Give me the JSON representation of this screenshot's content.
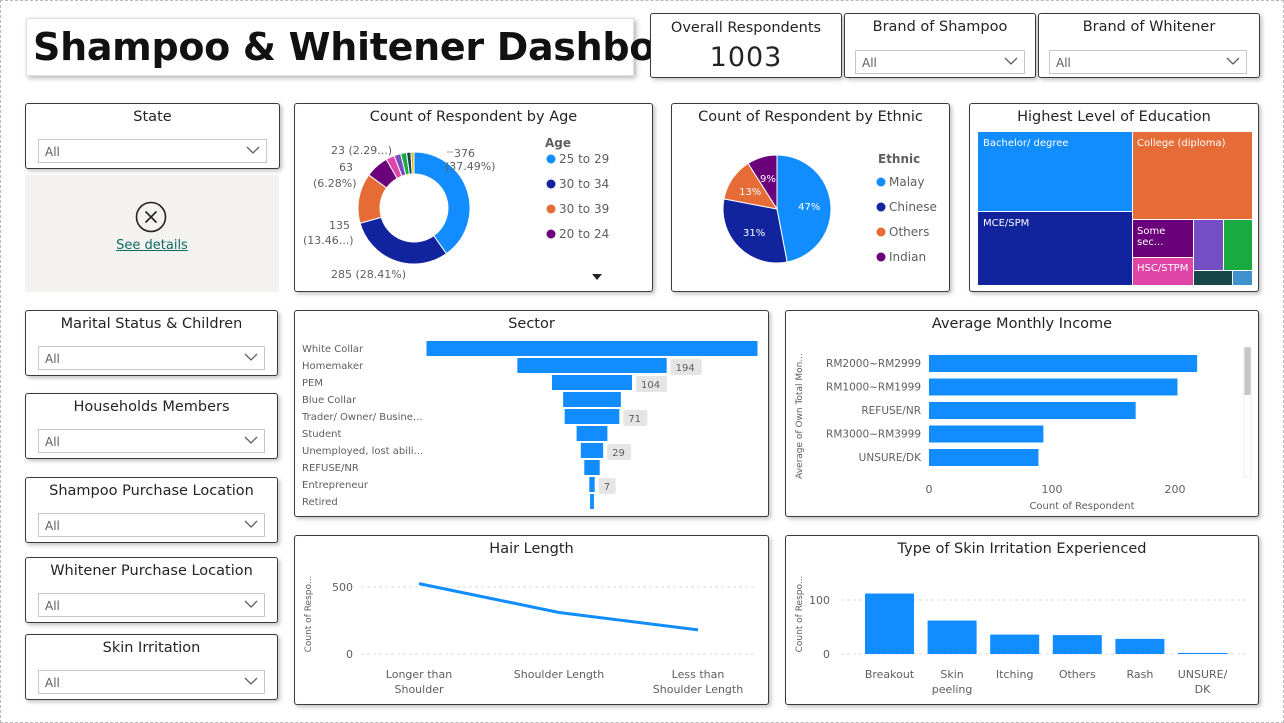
{
  "dashboard_title": "Shampoo & Whitener Dashboard",
  "overall": {
    "label": "Overall Respondents",
    "value": "1003"
  },
  "slicers": {
    "brand_shampoo": {
      "title": "Brand of Shampoo",
      "value": "All"
    },
    "brand_whitener": {
      "title": "Brand of Whitener",
      "value": "All"
    },
    "state": {
      "title": "State",
      "value": "All"
    },
    "marital": {
      "title": "Marital Status & Children",
      "value": "All"
    },
    "households": {
      "title": "Households Members",
      "value": "All"
    },
    "shampoo_loc": {
      "title": "Shampoo Purchase Location",
      "value": "All"
    },
    "whitener_loc": {
      "title": "Whitener Purchase Location",
      "value": "All"
    },
    "skin": {
      "title": "Skin Irritation",
      "value": "All"
    }
  },
  "error_visual": {
    "link": "See details"
  },
  "colors": {
    "blue": "#118DFF",
    "navy": "#12239E",
    "orange": "#E66C37",
    "purple": "#6B007B",
    "magenta": "#E044A7",
    "violet": "#744EC2",
    "green": "#1AAB40",
    "darkgreen": "#15474B",
    "lightblue": "#4092CE",
    "pink": "#D64550"
  },
  "chart_data": [
    {
      "id": "age",
      "type": "pie",
      "title": "Count of Respondent by Age",
      "legend_title": "Age",
      "legend_placement": "right",
      "categories": [
        "25 to 29",
        "30 to 34",
        "30 to 39",
        "20 to 24",
        "",
        "",
        "",
        "",
        ""
      ],
      "values": [
        376,
        285,
        135,
        63,
        23,
        18,
        16,
        12,
        8
      ],
      "colors": [
        "#118DFF",
        "#12239E",
        "#E66C37",
        "#6B007B",
        "#E044A7",
        "#744EC2",
        "#1AAB40",
        "#15474B",
        "#D9B300"
      ],
      "data_labels": [
        "376\n(37.49%)",
        "285 (28.41%)",
        "135\n(13.46...)",
        "63\n(6.28%)",
        "23 (2.29...)"
      ],
      "donut": true
    },
    {
      "id": "ethnic",
      "type": "pie",
      "title": "Count of Respondent by Ethnic",
      "legend_title": "Ethnic",
      "legend_placement": "right",
      "categories": [
        "Malay",
        "Chinese",
        "Others",
        "Indian"
      ],
      "values": [
        47,
        31,
        13,
        9
      ],
      "labels": [
        "47%",
        "31%",
        "13%",
        "9%"
      ],
      "colors": [
        "#118DFF",
        "#12239E",
        "#E66C37",
        "#6B007B"
      ]
    },
    {
      "id": "education",
      "type": "treemap",
      "title": "Highest Level of Education",
      "categories": [
        "Bachelor/ degree",
        "College (diploma)",
        "MCE/SPM",
        "Some sec...",
        "HSC/STPM",
        "",
        "",
        "",
        ""
      ],
      "colors": [
        "#118DFF",
        "#E66C37",
        "#12239E",
        "#6B007B",
        "#E044A7",
        "#744EC2",
        "#1AAB40",
        "#15474B",
        "#4092CE"
      ]
    },
    {
      "id": "sector",
      "type": "bar",
      "title": "Sector",
      "funnel": true,
      "categories": [
        "White Collar",
        "Homemaker",
        "PEM",
        "Blue Collar",
        "Trader/ Owner/ Busine...",
        "Student",
        "Unemployed, lost abili...",
        "REFUSE/NR",
        "Entrepreneur",
        "Retired"
      ],
      "values": [
        430,
        194,
        104,
        75,
        71,
        40,
        29,
        20,
        7,
        5
      ],
      "data_labels": [
        "",
        "194",
        "104",
        "",
        "71",
        "",
        "29",
        "",
        "7",
        ""
      ]
    },
    {
      "id": "income",
      "type": "bar",
      "orientation": "horizontal",
      "title": "Average Monthly Income",
      "categories": [
        "RM2000~RM2999",
        "RM1000~RM1999",
        "REFUSE/NR",
        "RM3000~RM3999",
        "UNSURE/DK"
      ],
      "values": [
        218,
        202,
        168,
        93,
        89
      ],
      "xlabel": "Count of Respondent",
      "ylabel": "Average of Own Total Mon...",
      "xticks": [
        "0",
        "100",
        "200"
      ],
      "xlim": [
        0,
        225
      ]
    },
    {
      "id": "hair",
      "type": "line",
      "title": "Hair Length",
      "categories": [
        "Longer than Shoulder",
        "Shoulder Length",
        "Less than Shoulder Length"
      ],
      "values": [
        525,
        310,
        180
      ],
      "ylabel": "Count of Respo...",
      "yticks": [
        "0",
        "500"
      ],
      "ylim": [
        0,
        600
      ]
    },
    {
      "id": "skin",
      "type": "bar",
      "title": "Type of Skin Irritation Experienced",
      "categories": [
        "Breakout",
        "Skin peeling",
        "Itching",
        "Others",
        "Rash",
        "UNSURE/ DK"
      ],
      "values": [
        112,
        62,
        36,
        35,
        28,
        2
      ],
      "ylabel": "Count of Respo...",
      "yticks": [
        "0",
        "100"
      ],
      "ylim": [
        0,
        125
      ]
    }
  ]
}
